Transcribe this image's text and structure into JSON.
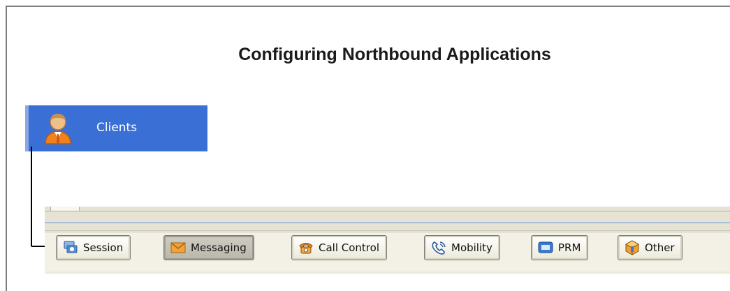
{
  "page": {
    "title": "Configuring Northbound Applications"
  },
  "clients": {
    "label": "Clients",
    "icon": "person-icon"
  },
  "toolbar": {
    "buttons": [
      {
        "label": "Session",
        "icon": "session-icon"
      },
      {
        "label": "Messaging",
        "icon": "envelope-icon",
        "active": true
      },
      {
        "label": "Call Control",
        "icon": "phone-icon"
      },
      {
        "label": "Mobility",
        "icon": "mobile-phone-icon"
      },
      {
        "label": "PRM",
        "icon": "monitor-icon"
      },
      {
        "label": "Other",
        "icon": "cube-icon"
      }
    ]
  }
}
